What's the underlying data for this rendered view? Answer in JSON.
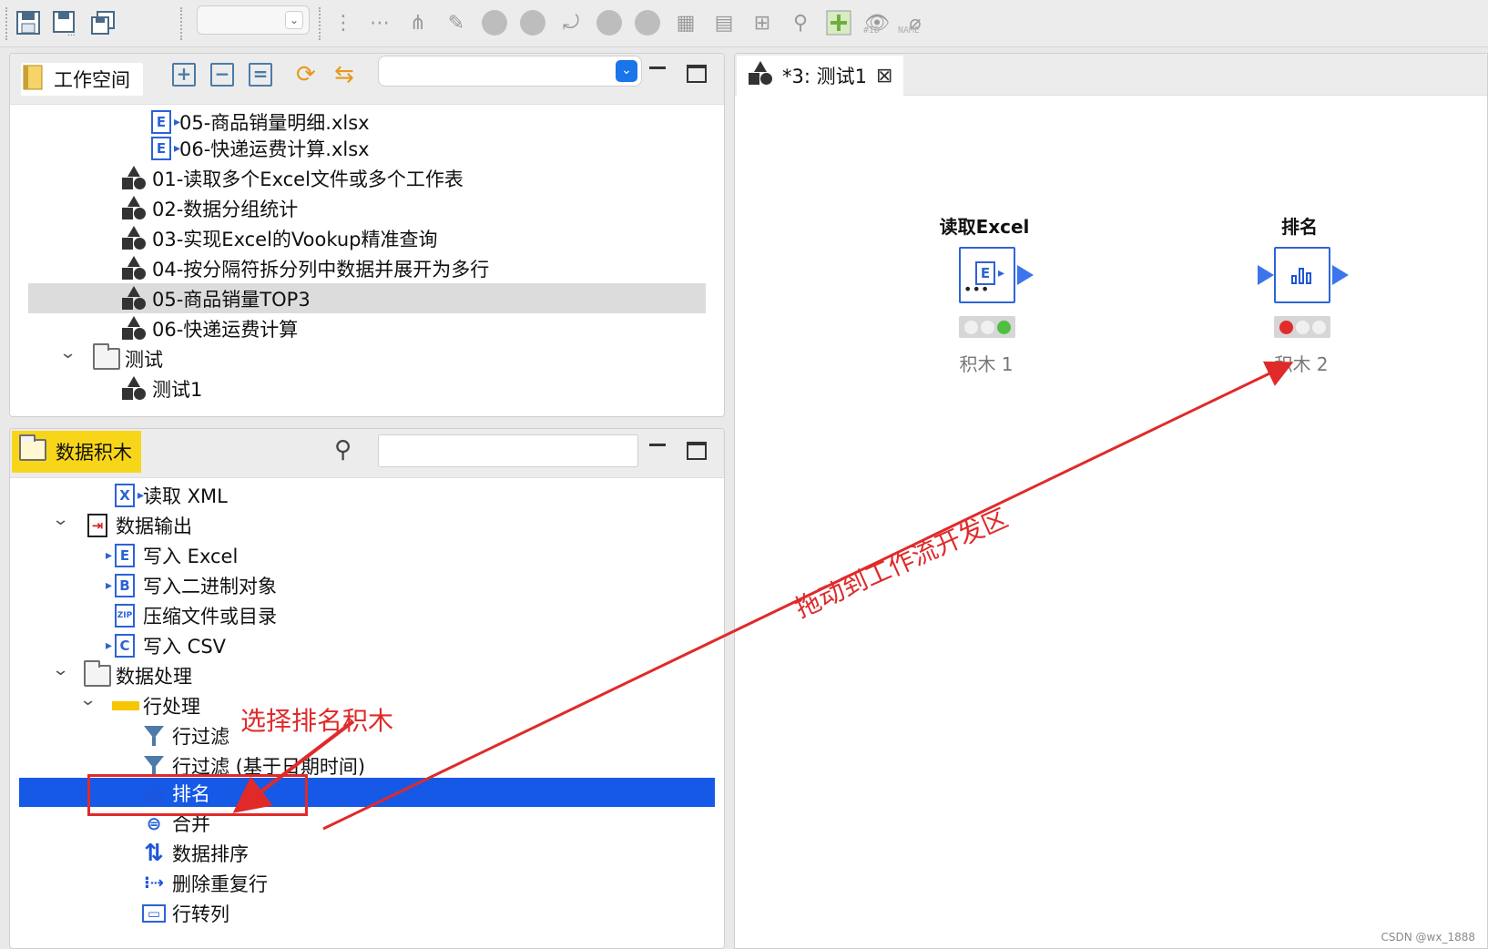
{
  "toolbar": {
    "combo_value": "",
    "id_label": "#ID",
    "name_label": "NAME"
  },
  "workspace": {
    "tab_label": "工作空间",
    "combo_value": "",
    "items": [
      {
        "label": "05-商品销量明细.xlsx",
        "icon": "excel-file-icon"
      },
      {
        "label": "06-快递运费计算.xlsx",
        "icon": "excel-file-icon"
      },
      {
        "label": "01-读取多个Excel文件或多个工作表",
        "icon": "flow-icon"
      },
      {
        "label": "02-数据分组统计",
        "icon": "flow-icon"
      },
      {
        "label": "03-实现Excel的Vookup精准查询",
        "icon": "flow-icon"
      },
      {
        "label": "04-按分隔符拆分列中数据并展开为多行",
        "icon": "flow-icon"
      },
      {
        "label": "05-商品销量TOP3",
        "icon": "flow-icon"
      },
      {
        "label": "06-快递运费计算",
        "icon": "flow-icon"
      },
      {
        "label": "测试",
        "icon": "folder-icon"
      },
      {
        "label": "测试1",
        "icon": "flow-icon"
      }
    ]
  },
  "blocks": {
    "tab_label": "数据积木",
    "search_value": "",
    "items": [
      {
        "label": "读取 XML"
      },
      {
        "label": "数据输出"
      },
      {
        "label": "写入 Excel"
      },
      {
        "label": "写入二进制对象"
      },
      {
        "label": "压缩文件或目录"
      },
      {
        "label": "写入 CSV"
      },
      {
        "label": "数据处理"
      },
      {
        "label": "行处理"
      },
      {
        "label": "行过滤"
      },
      {
        "label": "行过滤 (基于日期时间)"
      },
      {
        "label": "排名"
      },
      {
        "label": "合并"
      },
      {
        "label": "数据排序"
      },
      {
        "label": "删除重复行"
      },
      {
        "label": "行转列"
      }
    ]
  },
  "editor": {
    "tab_label": "*3: 测试1",
    "nodes": [
      {
        "title": "读取Excel",
        "label": "积木 1",
        "status": [
          "off",
          "off",
          "green"
        ]
      },
      {
        "title": "排名",
        "label": "积木 2",
        "status": [
          "red",
          "off",
          "off"
        ]
      }
    ]
  },
  "annotations": {
    "select_text": "选择排名积木",
    "drag_text": "拖动到工作流开发区",
    "color": "#e02a2a"
  },
  "watermark": "CSDN @wx_1888"
}
